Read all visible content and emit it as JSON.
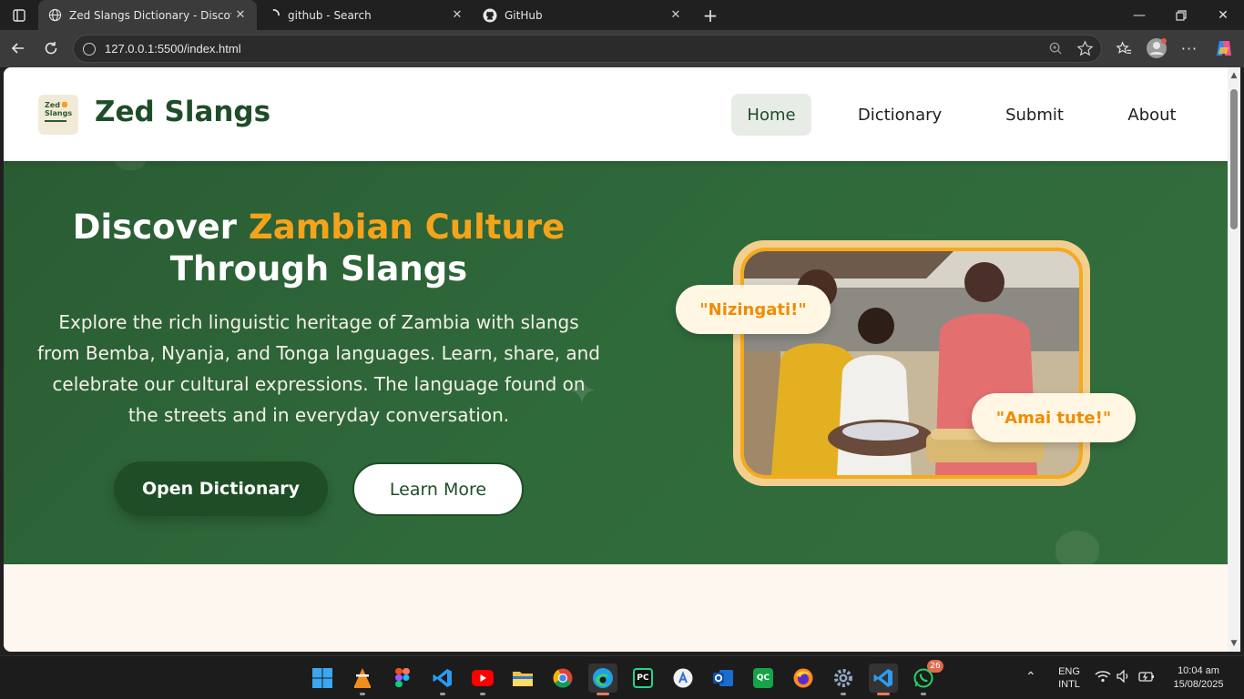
{
  "browser": {
    "tabs": [
      {
        "title": "Zed Slangs Dictionary - Discover Z",
        "icon": "globe-icon",
        "active": true
      },
      {
        "title": "github - Search",
        "icon": "loading-icon",
        "active": false
      },
      {
        "title": "GitHub",
        "icon": "github-icon",
        "active": false
      }
    ],
    "url": "127.0.0.1:5500/index.html"
  },
  "site": {
    "brand": "Zed Slangs",
    "logo_line1": "Zed",
    "logo_line2": "Slangs",
    "nav": [
      {
        "label": "Home",
        "active": true
      },
      {
        "label": "Dictionary",
        "active": false
      },
      {
        "label": "Submit",
        "active": false
      },
      {
        "label": "About",
        "active": false
      }
    ]
  },
  "hero": {
    "title_part1": "Discover ",
    "title_accent": "Zambian Culture",
    "title_part2": "Through Slangs",
    "description": "Explore the rich linguistic heritage of Zambia with slangs from Bemba, Nyanja, and Tonga languages. Learn, share, and celebrate our cultural expressions. The language found on the streets and in everyday conversation.",
    "primary_button": "Open Dictionary",
    "secondary_button": "Learn More",
    "bubble1": "\"Nizingati!\"",
    "bubble2": "\"Amai tute!\"",
    "accent_color": "#f4a31b",
    "brand_green": "#1f4d29"
  },
  "taskbar": {
    "apps": [
      "windows-start-icon",
      "vlc-icon",
      "figma-icon",
      "vscode-icon",
      "youtube-icon",
      "file-explorer-icon",
      "chrome-icon",
      "edge-icon",
      "pycharm-icon",
      "app-store-icon",
      "outlook-icon",
      "qc-icon",
      "firefox-icon",
      "settings-icon",
      "vscode-icon",
      "whatsapp-icon"
    ],
    "whatsapp_badge": "26",
    "language_line1": "ENG",
    "language_line2": "INTL",
    "time": "10:04 am",
    "date": "15/08/2025"
  }
}
